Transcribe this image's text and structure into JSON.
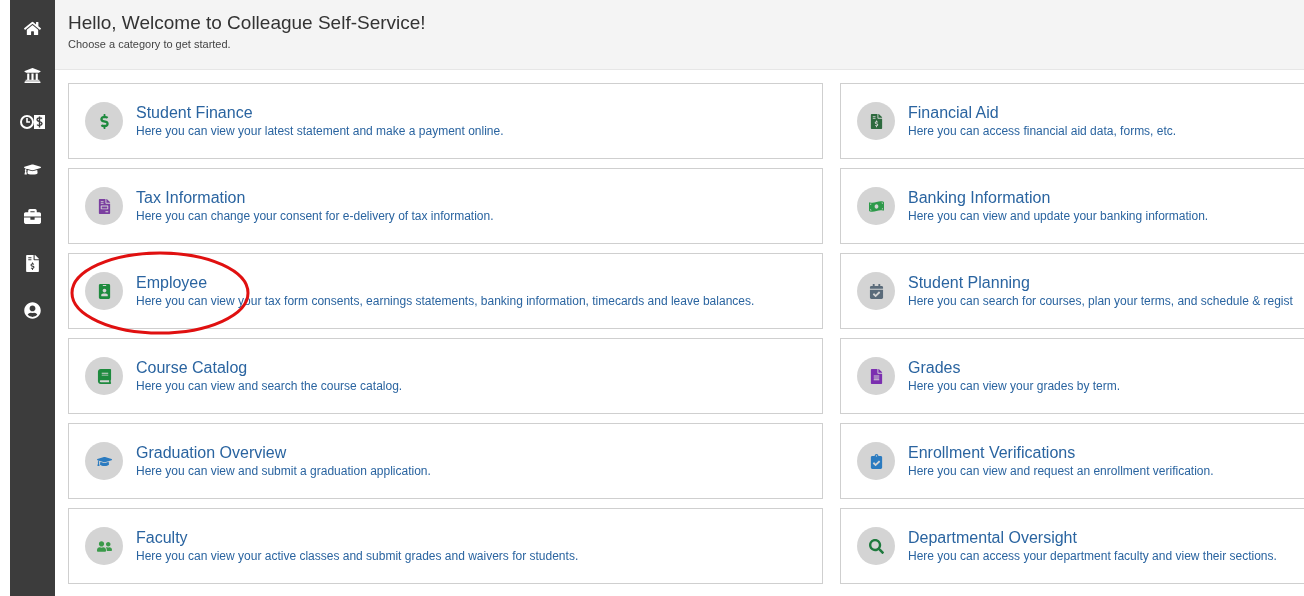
{
  "header": {
    "title": "Hello, Welcome to Colleague Self-Service!",
    "subtitle": "Choose a category to get started."
  },
  "columns": [
    [
      {
        "title": "Student Finance",
        "description": "Here you can view your latest statement and make a payment online.",
        "highlighted": false
      },
      {
        "title": "Tax Information",
        "description": "Here you can change your consent for e-delivery of tax information.",
        "highlighted": false
      },
      {
        "title": "Employee",
        "description": "Here you can view your tax form consents, earnings statements, banking information, timecards and leave balances.",
        "highlighted": true
      },
      {
        "title": "Course Catalog",
        "description": "Here you can view and search the course catalog.",
        "highlighted": false
      },
      {
        "title": "Graduation Overview",
        "description": "Here you can view and submit a graduation application.",
        "highlighted": false
      },
      {
        "title": "Faculty",
        "description": "Here you can view your active classes and submit grades and waivers for students.",
        "highlighted": false
      }
    ],
    [
      {
        "title": "Financial Aid",
        "description": "Here you can access financial aid data, forms, etc.",
        "highlighted": false
      },
      {
        "title": "Banking Information",
        "description": "Here you can view and update your banking information.",
        "highlighted": false
      },
      {
        "title": "Student Planning",
        "description": "Here you can search for courses, plan your terms, and schedule & regist",
        "highlighted": false
      },
      {
        "title": "Grades",
        "description": "Here you can view your grades by term.",
        "highlighted": false
      },
      {
        "title": "Enrollment Verifications",
        "description": "Here you can view and request an enrollment verification.",
        "highlighted": false
      },
      {
        "title": "Departmental Oversight",
        "description": "Here you can access your department faculty and view their sections.",
        "highlighted": false
      }
    ]
  ]
}
